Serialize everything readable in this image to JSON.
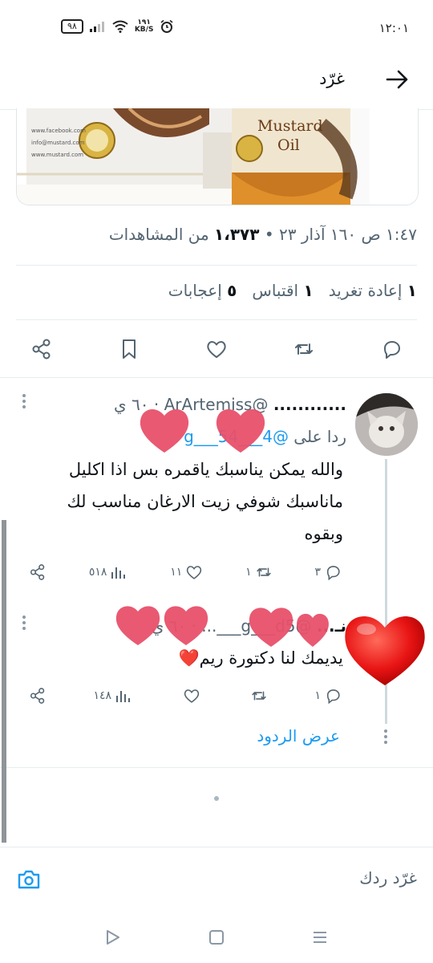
{
  "status_bar": {
    "time": "١٢:٠١",
    "battery": "٩٨",
    "net_speed_value": "١٩١",
    "net_speed_unit": "KB/S"
  },
  "header": {
    "title": "غرّد"
  },
  "product_image": {
    "brand_text_1": "Mustard",
    "brand_text_2": "Oil"
  },
  "tweet_meta": {
    "time_date": "١:٤٧ ص ١٦٠ آذار ٢٣ •",
    "views_count": "١،٣٧٣",
    "views_label": "من المشاهدات"
  },
  "stats": {
    "retweets_count": "١",
    "retweets_label": "إعادة تغريد",
    "quotes_count": "١",
    "quotes_label": "اقتباس",
    "likes_count": "٥",
    "likes_label": "إعجابات"
  },
  "replies": [
    {
      "name": "............",
      "handle": "@ArArtemiss",
      "time": "٦٠ ي",
      "replying_to_label": "ردا على",
      "replying_to_handle": "@g___54___4",
      "text": "والله يمكن يناسبك ياقمره بس اذا اكليل ماناسبك شوفي زيت الارغان مناسب لك وبقوه",
      "replies_count": "٣",
      "retweets_count": "١",
      "likes_count": "١١",
      "views_count": "٥١٨"
    },
    {
      "name": "نـ...",
      "handle": "@g___d5___...",
      "time": "٦٠ ي",
      "text": "يديمك لنا دكتورة ريم",
      "emoji": "❤️",
      "replies_count": "١",
      "retweets_count": "",
      "likes_count": "",
      "views_count": "١٤٨"
    }
  ],
  "view_replies": "عرض الردود",
  "compose": {
    "placeholder": "غرّد ردك"
  },
  "colors": {
    "accent": "#1d9bf0",
    "text": "#0f1419",
    "muted": "#536471",
    "heart": "#e8506a"
  }
}
